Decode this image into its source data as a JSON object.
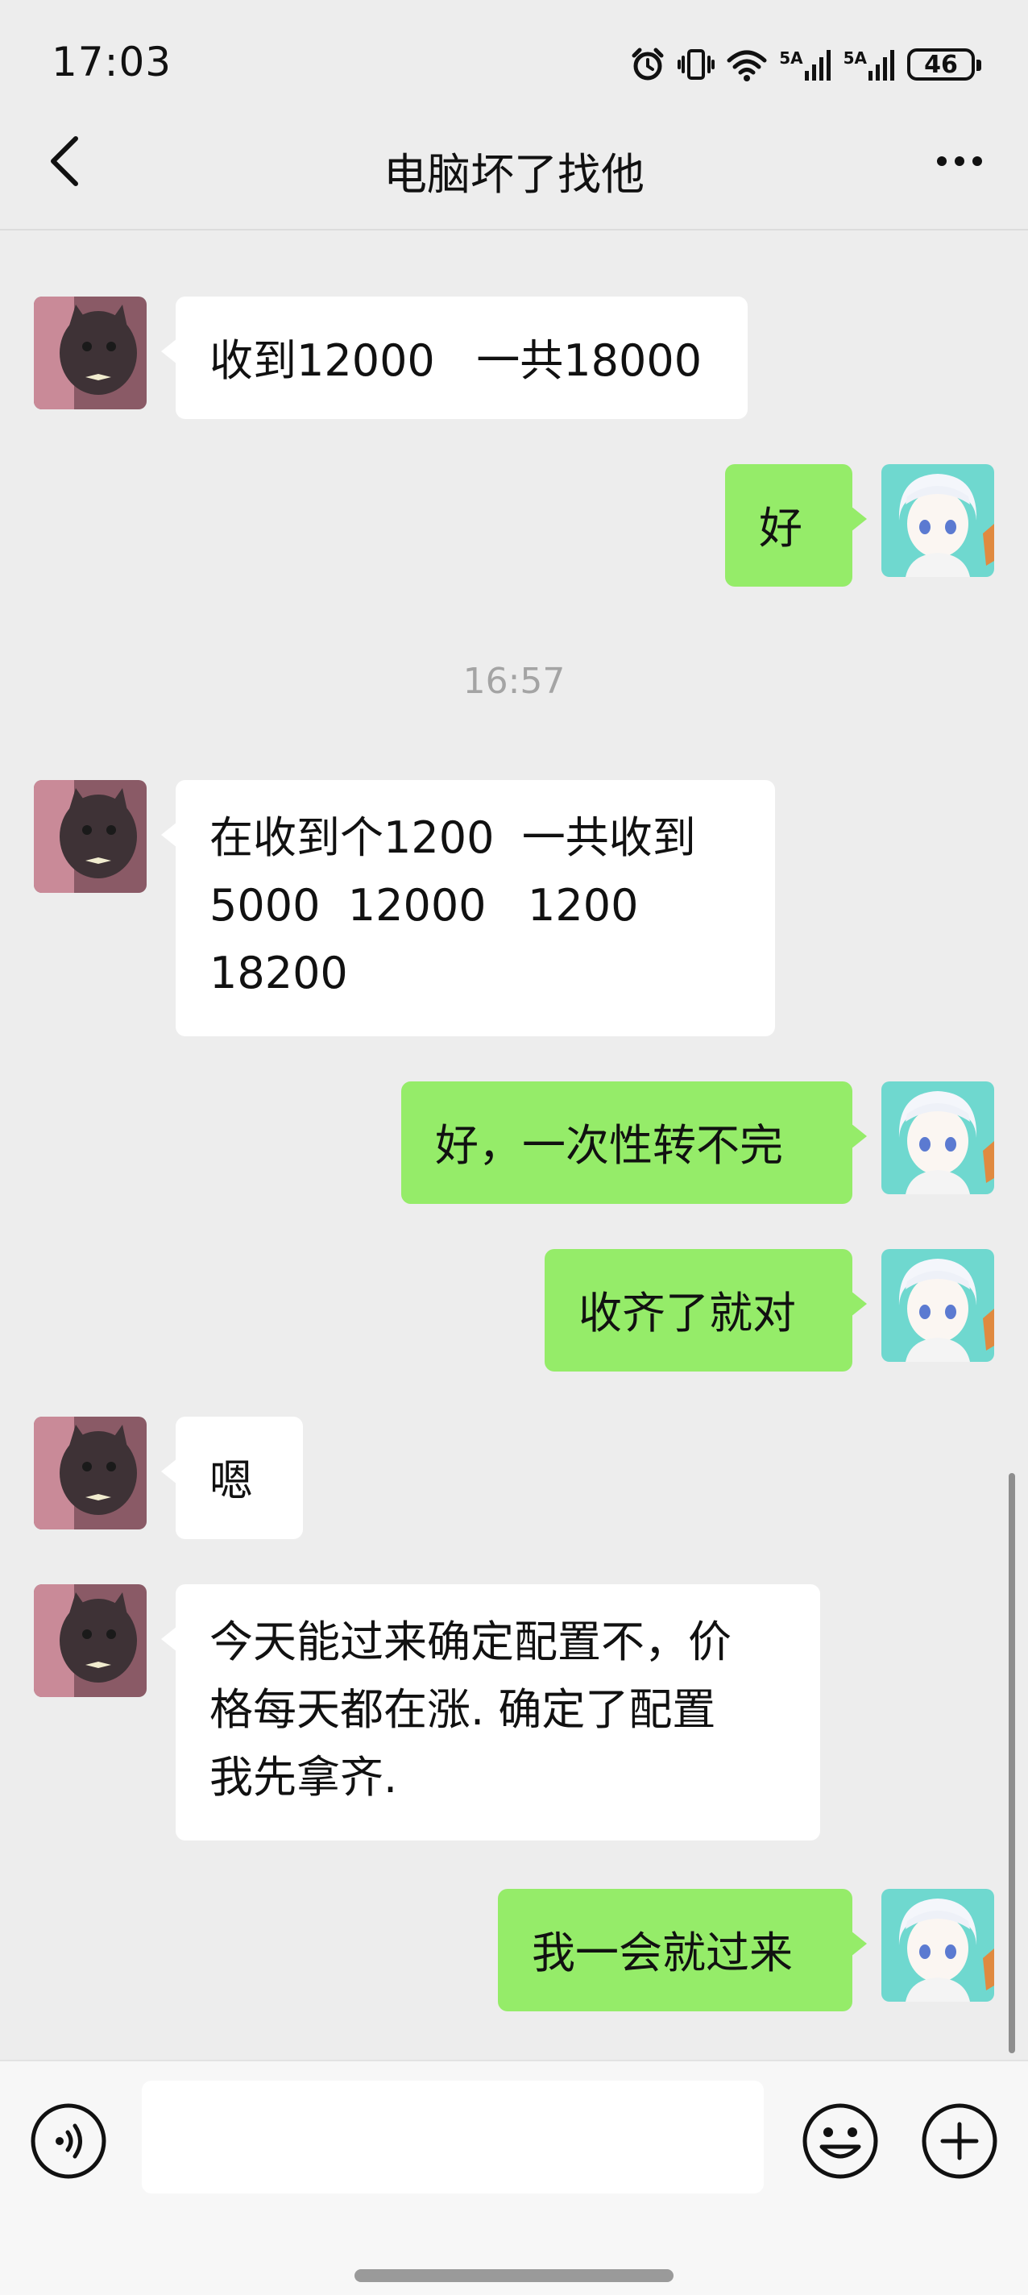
{
  "status_bar": {
    "time": "17:03",
    "network1": "5A",
    "network2": "5A",
    "battery": "46"
  },
  "header": {
    "title": "电脑坏了找他"
  },
  "messages": [
    {
      "side": "in",
      "text": "收到12000   一共18000"
    },
    {
      "side": "out",
      "text": "好"
    },
    {
      "side": "time",
      "text": "16:57"
    },
    {
      "side": "in",
      "text": "在收到个1200  一共收到\n5000  12000   1200\n18200"
    },
    {
      "side": "out",
      "text": "好，一次性转不完"
    },
    {
      "side": "out",
      "text": "收齐了就对"
    },
    {
      "side": "in",
      "text": "嗯"
    },
    {
      "side": "in",
      "text": "今天能过来确定配置不，价\n格每天都在涨. 确定了配置\n我先拿齐."
    },
    {
      "side": "out",
      "text": "我一会就过来"
    }
  ],
  "input": {
    "placeholder": ""
  },
  "colors": {
    "accent_bubble": "#95ec69",
    "background": "#ededed"
  },
  "icons": {
    "back": "chevron-left-icon",
    "more": "more-dots-icon",
    "voice": "voice-icon",
    "emoji": "emoji-icon",
    "plus": "plus-icon"
  }
}
